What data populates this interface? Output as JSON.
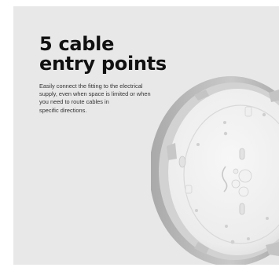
{
  "headline": {
    "line1": "5 cable",
    "line2": "entry points"
  },
  "description": {
    "line1": "Easily connect the fitting to the electrical",
    "line2": "supply, even when space is limited or when",
    "line3": "you need to route cables in",
    "line4": "specific directions."
  },
  "colors": {
    "panel_background": "#e8e8e8",
    "headline": "#111111",
    "body_text": "#333333",
    "fitting_body": "#f4f4f4",
    "fitting_rim": "#bdbdbd"
  },
  "image": {
    "subject": "light-fitting-base-icon"
  }
}
